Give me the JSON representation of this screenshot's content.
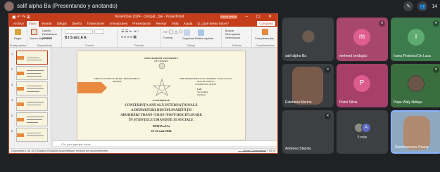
{
  "meet": {
    "presenter_label": "salif alpha Ba (Presentando y anotando)",
    "participant_count": "14"
  },
  "ppt": {
    "doc_title": "Noviembre 2024 - compat...ble - PowerPoint",
    "signin_label": "Iniciar sesión",
    "tabs": [
      "Archivo",
      "Inicio",
      "Insertar",
      "Dibujar",
      "Diseño",
      "Transiciones",
      "Animaciones",
      "Presentación",
      "Revisar",
      "Vista",
      "Ayuda",
      "Q ¿Qué desea hacer?"
    ],
    "share_label": "Compartir",
    "ribbon": {
      "groups": [
        "Portapapeles",
        "Diapositivas",
        "Fuente",
        "Párrafo",
        "Dibujo",
        "Edición",
        "Complementos"
      ],
      "paste_label": "Pegar",
      "new_slide_label": "Nueva diapositiva",
      "layout_label": "Diseño",
      "reset_label": "Restablecer",
      "section_label": "Sección",
      "find_label": "Buscar",
      "replace_label": "Reemplazar",
      "select_label": "Seleccionar",
      "addins_label": "Complementos",
      "arrange_label": "Organizar",
      "styles_label": "Estilos rápidos",
      "shapes_label": "Formas"
    },
    "thumb_numbers": [
      "1",
      "2",
      "3",
      "4",
      "5",
      "6"
    ],
    "slide": {
      "univ_1": "JOHN MARCHI UNIVERSITY",
      "univ_2": "OF CHAVAN",
      "dept_left_1": "THE TEACHER TRAINING DEPARTMENT",
      "dept_left_2": "ABIJAM",
      "dept_right_1": "THE DEPARTMENT OF MODERN LANGUAGES AND BUSINESS",
      "dept_right_2": "COMMUNICATION",
      "mid_1": "LAB",
      "mid_2": "Yet Marking",
      "mid_3": "Marquand",
      "conference": "CONFERENCE",
      "title_1": "CONFERINȚA ANUALĂ INTERNAȚIONALĂ",
      "title_2": "A DEZBATERII DISCIPLINARITĂȚII",
      "title_3": "ABORDĂRI TRANS-/CROS-/POST-DISCIPLINARE",
      "title_4": "ÎN ȘTIINȚELE UMANISTE ȘI SOCIALE",
      "edition": "EDIȚIA a II-a",
      "date": "21-22 mai 2024"
    },
    "notes_placeholder": "Clic para agregar notas",
    "status_left": "Diapositiva 1 de 10   [] Español (España)   Accesibilidad: revisión sin inconvenientes",
    "status_right": "Notas   Comentarios        +   55 %"
  },
  "tiles": [
    {
      "name": "salif alpha Ba",
      "bg": "#3c4043",
      "type": "photo"
    },
    {
      "name": "mehmet serdagici",
      "bg": "#a6476b",
      "type": "letter",
      "letter": "m",
      "avatar": "#e05d8f"
    },
    {
      "name": "Ivana Pistorosi De Luca",
      "bg": "#3d7a4c",
      "type": "letter",
      "letter": "I",
      "avatar": "#5dab70"
    },
    {
      "name": "Estefania Merino",
      "bg": "#3a3d40",
      "type": "photo"
    },
    {
      "name": "Pistol Silvia",
      "bg": "#a63f6a",
      "type": "letter",
      "letter": "P",
      "avatar": "#dd5c90"
    },
    {
      "name": "Pape Waly Ndiaye",
      "bg": "#3b6e3f",
      "type": "photo"
    },
    {
      "name": "Andreea Stanciu",
      "bg": "#3c4043",
      "type": "blank"
    },
    {
      "name": "5 más",
      "bg": "#3c4043",
      "type": "more",
      "letter": "A"
    },
    {
      "name": "Dumbraveanu Oxana",
      "bg": "#8ea8c2",
      "type": "photo"
    }
  ]
}
